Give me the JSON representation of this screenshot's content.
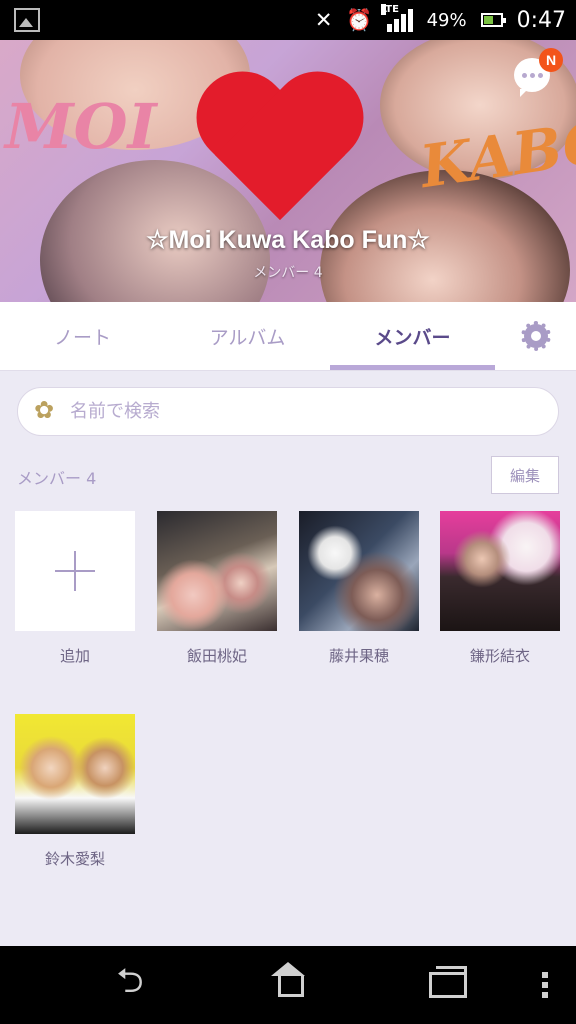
{
  "status_bar": {
    "battery_percent": "49%",
    "time": "0:47",
    "network": "LTE",
    "icons": [
      "picture-icon",
      "bluetooth-off-icon",
      "alarm-clock-icon",
      "signal-icon",
      "battery-icon"
    ]
  },
  "group": {
    "title": "☆Moi Kuwa Kabo Fun☆",
    "subtitle": "メンバー 4",
    "notification_badge": "N",
    "cover_text_left": "MOI",
    "cover_text_right": "KABO"
  },
  "tabs": [
    {
      "label": "ノート",
      "active": false
    },
    {
      "label": "アルバム",
      "active": false
    },
    {
      "label": "メンバー",
      "active": true
    }
  ],
  "search": {
    "placeholder": "名前で検索"
  },
  "members_section": {
    "count_label": "メンバー 4",
    "edit_label": "編集"
  },
  "members": [
    {
      "name": "追加",
      "type": "add"
    },
    {
      "name": "飯田桃妃",
      "type": "member"
    },
    {
      "name": "藤井果穂",
      "type": "member"
    },
    {
      "name": "鎌形結衣",
      "type": "member"
    },
    {
      "name": "鈴木愛梨",
      "type": "member"
    }
  ],
  "colors": {
    "accent": "#5a4a8a",
    "tab_inactive": "#a99cc6",
    "tab_indicator": "#b9a8d8",
    "background": "#eceaf4",
    "badge": "#f3541a"
  },
  "nav_bar": {
    "icons": [
      "back-icon",
      "home-icon",
      "recent-apps-icon",
      "menu-icon"
    ]
  }
}
